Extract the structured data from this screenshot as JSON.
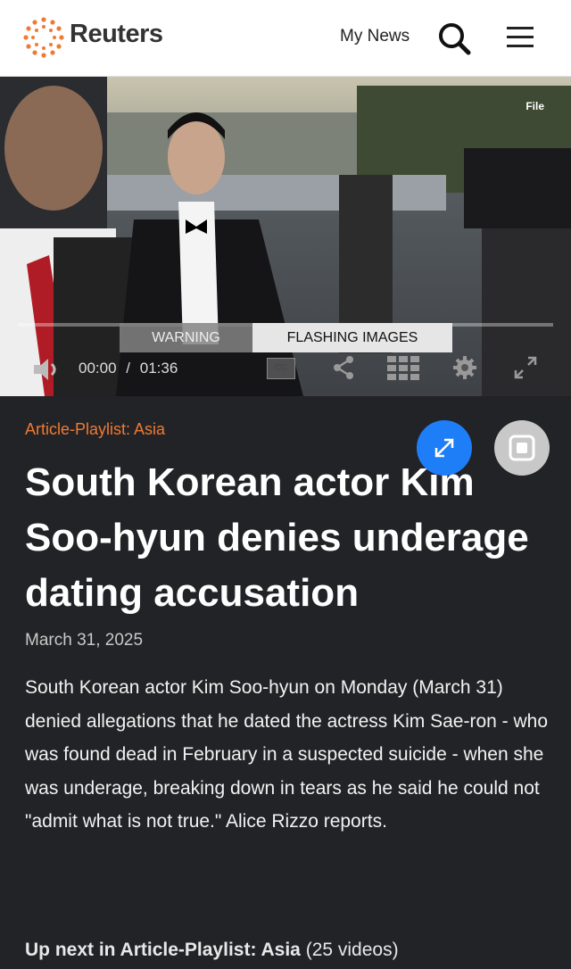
{
  "header": {
    "logo_text": "Reuters",
    "my_news": "My News"
  },
  "video": {
    "file_label": "File",
    "warning_left": "WARNING",
    "warning_right": "FLASHING IMAGES",
    "current_time": "00:00",
    "time_separator": "/",
    "duration": "01:36",
    "cc_label": "CC"
  },
  "article": {
    "category": "Article-Playlist: Asia",
    "title": "South Korean actor Kim Soo-hyun denies underage dating accusation",
    "date": "March 31, 2025",
    "description": "South Korean actor Kim Soo-hyun on Monday (March 31) denied allegations that he dated the actress Kim Sae-ron - who was found dead in February in a suspected suicide - when she was underage, breaking down in tears as he said he could not \"admit what is not true.\" Alice Rizzo reports."
  },
  "up_next": {
    "prefix": "Up next in Article-Playlist: Asia",
    "count": "(25 videos)"
  },
  "colors": {
    "accent": "#f07a33",
    "expand_button": "#1e7ef7",
    "background": "#222326"
  },
  "icons": [
    "reuters-logo-icon",
    "search-icon",
    "menu-icon",
    "volume-icon",
    "share-icon",
    "grid-icon",
    "settings-gear-icon",
    "fullscreen-icon",
    "expand-icon",
    "picture-in-picture-icon"
  ]
}
